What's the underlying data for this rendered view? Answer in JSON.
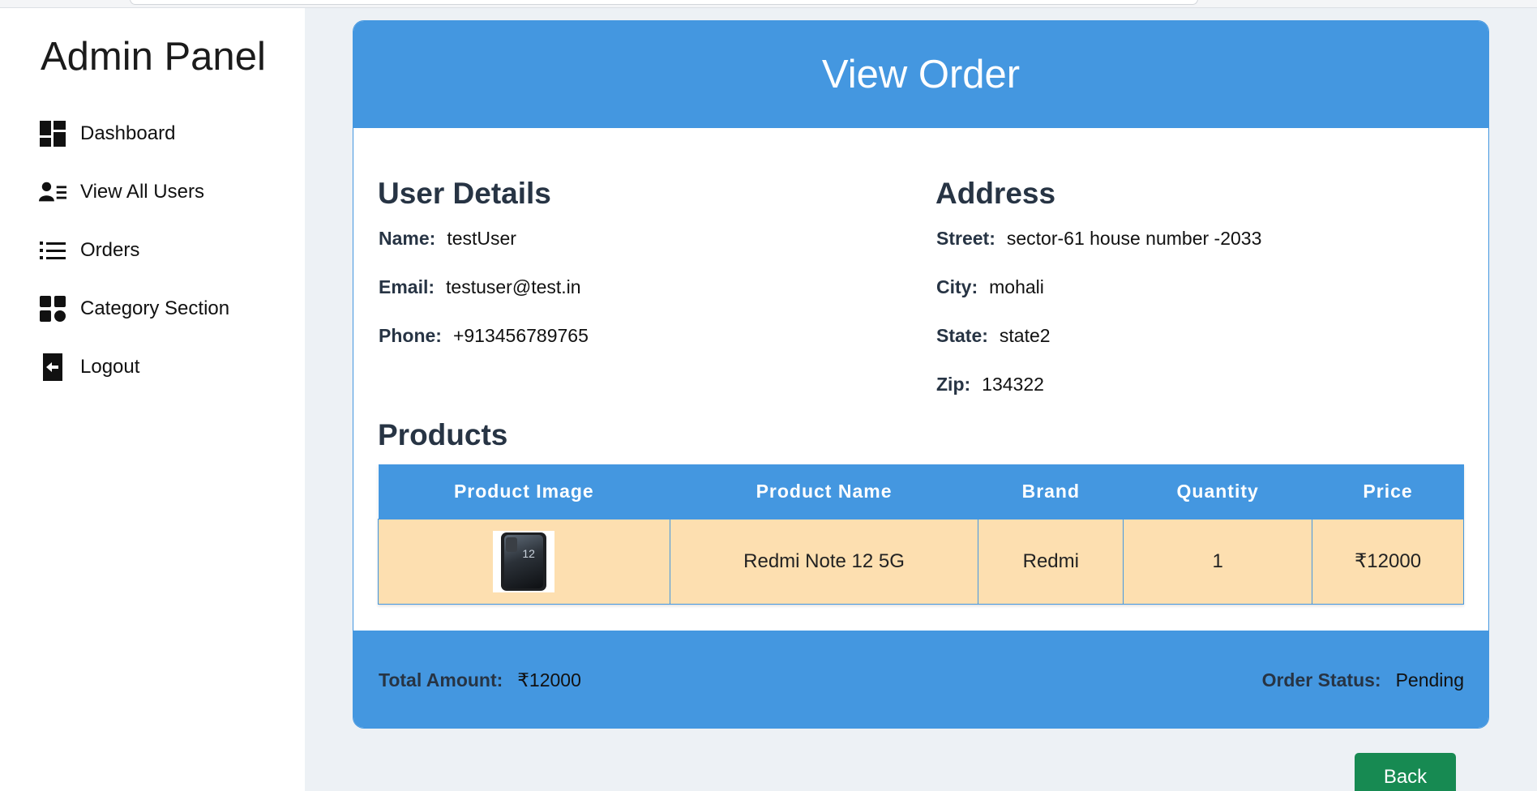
{
  "sidebar": {
    "title": "Admin Panel",
    "items": [
      {
        "label": "Dashboard",
        "icon": "dashboard-icon"
      },
      {
        "label": "View All Users",
        "icon": "users-list-icon"
      },
      {
        "label": "Orders",
        "icon": "list-icon"
      },
      {
        "label": "Category Section",
        "icon": "category-icon"
      },
      {
        "label": "Logout",
        "icon": "logout-icon"
      }
    ]
  },
  "header": {
    "title": "View Order"
  },
  "user_details": {
    "title": "User Details",
    "name_label": "Name:",
    "name": "testUser",
    "email_label": "Email:",
    "email": "testuser@test.in",
    "phone_label": "Phone:",
    "phone": "+913456789765"
  },
  "address": {
    "title": "Address",
    "street_label": "Street:",
    "street": "sector-61 house number -2033",
    "city_label": "City:",
    "city": "mohali",
    "state_label": "State:",
    "state": "state2",
    "zip_label": "Zip:",
    "zip": "134322"
  },
  "products": {
    "title": "Products",
    "columns": [
      "Product Image",
      "Product Name",
      "Brand",
      "Quantity",
      "Price"
    ],
    "rows": [
      {
        "image_icon": "phone-image",
        "image_text": "12",
        "name": "Redmi Note 12 5G",
        "brand": "Redmi",
        "quantity": "1",
        "price": "₹12000"
      }
    ]
  },
  "footer": {
    "total_label": "Total Amount:",
    "total": "₹12000",
    "status_label": "Order Status:",
    "status": "Pending"
  },
  "back_label": "Back",
  "colors": {
    "accent": "#4497e0",
    "row_bg": "#fddfb0",
    "back_button": "#178a52",
    "page_bg": "#edf1f5"
  }
}
